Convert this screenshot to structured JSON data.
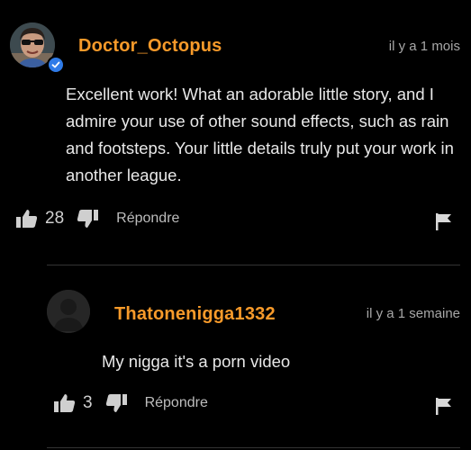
{
  "comments": [
    {
      "username": "Doctor_Octopus",
      "time": "il y a 1 mois",
      "verified": true,
      "text": "Excellent work! What an adorable little story, and I admire your use of other sound effects, such as rain and footsteps. Your little details truly put your work in another league.",
      "likes": "28",
      "reply_label": "Répondre"
    },
    {
      "username": "Thatonenigga1332",
      "time": "il y a 1 semaine",
      "verified": false,
      "text": "My nigga it's a porn video",
      "likes": "3",
      "reply_label": "Répondre"
    }
  ],
  "colors": {
    "background": "#000000",
    "username": "#f79a2a",
    "verified_badge": "#2f7be8",
    "timestamp": "#a8a8a8"
  },
  "icons": [
    "thumbs-up-icon",
    "thumbs-down-icon",
    "flag-icon",
    "verified-check-icon"
  ]
}
